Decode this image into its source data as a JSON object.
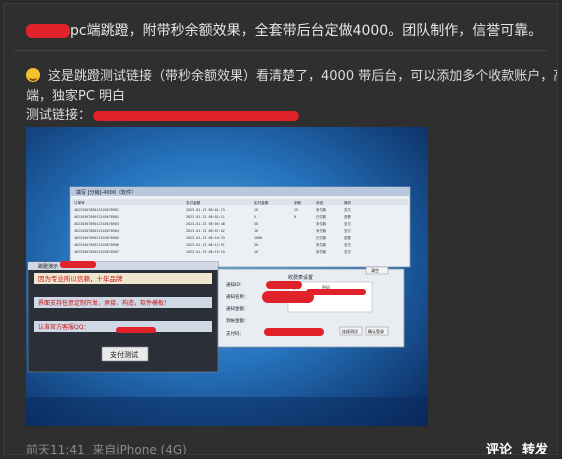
{
  "post": {
    "headline": "pc端跳蹬，附带秒余额效果，全套带后台定做4000。团队制作，信誉可靠。",
    "line1": "这是跳蹬测试链接（带秒余额效果）看清楚了，4000 带后台，可以添加多个收款账户，高",
    "line2": "端，独家PC 明白",
    "link_label": "测试链接：",
    "emoji_icon": "smile-emoji-icon"
  },
  "photo": {
    "window_title": "填写 [分销]-4000（软件）",
    "table_headers": [
      "订单号",
      "支付金额",
      "实付金额",
      "到帐",
      "状态",
      "操作"
    ],
    "table_rows": [
      [
        "4623456789012345678901",
        "2023-01-13 08:01:23",
        "10",
        "25",
        "未付款",
        "支付"
      ],
      [
        "4623456789012345678902",
        "2023-01-13 08:02:11",
        "5",
        "8",
        "已付款",
        "查看"
      ],
      [
        "4623456789012345678903",
        "2023-01-13 08:05:40",
        "50",
        "",
        "未付款",
        "支付"
      ],
      [
        "4623456789012345678904",
        "2023-01-13 08:07:02",
        "10",
        "",
        "未付款",
        "支付"
      ],
      [
        "4623456789012345678905",
        "2023-01-13 08:10:33",
        "1000",
        "",
        "已付款",
        "查看"
      ],
      [
        "4623456789012345678906",
        "2023-01-13 08:12:51",
        "30",
        "",
        "未付款",
        "支付"
      ],
      [
        "4623456789012345678907",
        "2023-01-13 08:15:19",
        "10",
        "",
        "未付款",
        "支付"
      ]
    ],
    "popup_title": "跳蹬演示",
    "popup_line1": "因为专业所以信赖，十年品牌",
    "popup_line2": "界面支持任意定制开发，承接、构造，软件模板！",
    "popup_line3": "认准官方客服QQ：",
    "popup_button": "支付测试",
    "form_header": "收费表设置",
    "form_labels": [
      "通知ID：",
      "通知名称：",
      "通知金额：",
      "到帐金额：",
      "支付码："
    ],
    "form_col1": "账号",
    "form_col2": "密码",
    "form_btn1": "清空",
    "form_btn2": "连接测试",
    "form_btn3": "确认登录"
  },
  "footer": {
    "time": "前天11:41",
    "source": "来自iPhone (4G)",
    "comment": "评论",
    "repost": "转发"
  },
  "colors": {
    "background": "#2b2b2b",
    "card": "#2f2f2f",
    "redact": "#e0222a",
    "footer_gray": "#8a8a8a"
  }
}
